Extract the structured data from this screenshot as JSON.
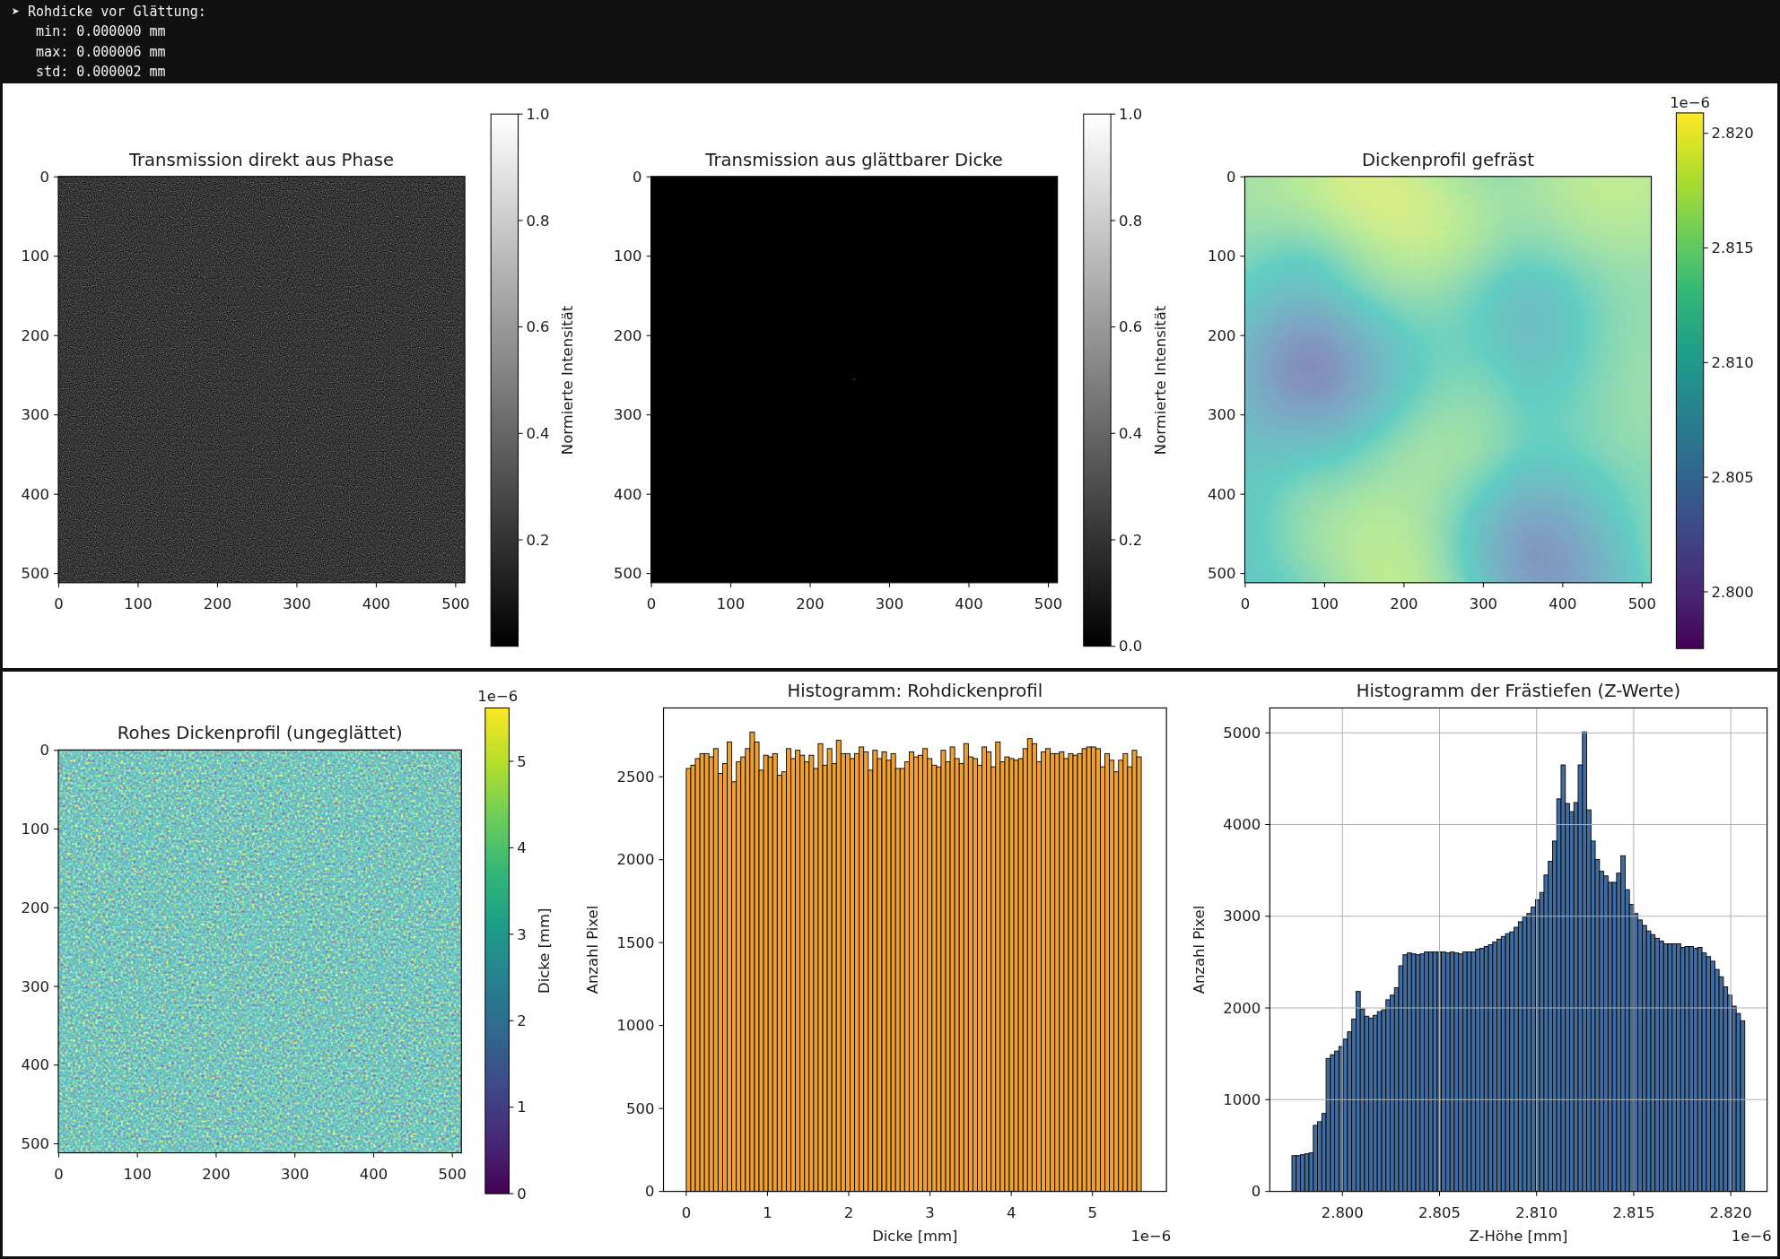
{
  "terminal": {
    "lines": [
      "➤ Rohdicke vor Glättung:",
      "   min: 0.000000 mm",
      "   max: 0.000006 mm",
      "   std: 0.000002 mm"
    ]
  },
  "figures": [
    {
      "panels": [
        {
          "kind": "speckle",
          "title": "Transmission direkt aus Phase",
          "xticks": [
            "0",
            "100",
            "200",
            "300",
            "400",
            "500"
          ],
          "yticks": [
            "0",
            "100",
            "200",
            "300",
            "400",
            "500"
          ],
          "colorbar": {
            "label": "Normierte Intensität",
            "ticks": [
              "1.0",
              "0.8",
              "0.6",
              "0.4",
              "0.2"
            ]
          }
        },
        {
          "kind": "blank",
          "title": "Transmission aus glättbarer Dicke",
          "xticks": [
            "0",
            "100",
            "200",
            "300",
            "400",
            "500"
          ],
          "yticks": [
            "0",
            "100",
            "200",
            "300",
            "400",
            "500"
          ],
          "colorbar": {
            "label": "Normierte Intensität",
            "ticks": [
              "1.0",
              "0.8",
              "0.6",
              "0.4",
              "0.2",
              "0.0"
            ]
          }
        },
        {
          "kind": "smooth",
          "title": "Dickenprofil gefräst",
          "xticks": [
            "0",
            "100",
            "200",
            "300",
            "400",
            "500"
          ],
          "yticks": [
            "0",
            "100",
            "200",
            "300",
            "400",
            "500"
          ],
          "colorbar": {
            "offset_text": "1e−6",
            "ticks": [
              "2.820",
              "2.815",
              "2.810",
              "2.805",
              "2.800"
            ]
          }
        }
      ]
    },
    {
      "panels": [
        {
          "kind": "noise",
          "title": "Rohes Dickenprofil (ungeglättet)",
          "xticks": [
            "0",
            "100",
            "200",
            "300",
            "400",
            "500"
          ],
          "yticks": [
            "0",
            "100",
            "200",
            "300",
            "400",
            "500"
          ],
          "colorbar": {
            "label": "Dicke [mm]",
            "offset_text": "1e−6",
            "ticks": [
              "5",
              "4",
              "3",
              "2",
              "1",
              "0"
            ]
          }
        },
        {
          "kind": "histogram",
          "chart_data": {
            "type": "bar",
            "title": "Histogramm: Rohdickenprofil",
            "xlabel": "Dicke [mm]",
            "ylabel": "Anzahl Pixel",
            "annotations": [
              {
                "text": "1e−6"
              }
            ],
            "x": [
              0.028,
              0.084,
              0.14,
              0.196,
              0.252,
              0.308,
              0.364,
              0.42,
              0.476,
              0.532,
              0.588,
              0.644,
              0.7,
              0.756,
              0.812,
              0.868,
              0.924,
              0.98,
              1.036,
              1.092,
              1.148,
              1.204,
              1.26,
              1.316,
              1.372,
              1.428,
              1.484,
              1.54,
              1.596,
              1.652,
              1.708,
              1.764,
              1.82,
              1.876,
              1.932,
              1.988,
              2.044,
              2.1,
              2.156,
              2.212,
              2.268,
              2.324,
              2.38,
              2.436,
              2.492,
              2.548,
              2.604,
              2.66,
              2.716,
              2.772,
              2.828,
              2.884,
              2.94,
              2.996,
              3.052,
              3.108,
              3.164,
              3.22,
              3.276,
              3.332,
              3.388,
              3.444,
              3.5,
              3.556,
              3.612,
              3.668,
              3.724,
              3.78,
              3.836,
              3.892,
              3.948,
              4.004,
              4.06,
              4.116,
              4.172,
              4.228,
              4.284,
              4.34,
              4.396,
              4.452,
              4.508,
              4.564,
              4.62,
              4.676,
              4.732,
              4.788,
              4.844,
              4.9,
              4.956,
              5.012,
              5.068,
              5.124,
              5.18,
              5.236,
              5.292,
              5.348,
              5.404,
              5.46,
              5.516,
              5.572
            ],
            "series": [
              {
                "color": "#f0a030",
                "values": [
                  2550,
                  2570,
                  2610,
                  2640,
                  2640,
                  2620,
                  2670,
                  2520,
                  2580,
                  2710,
                  2470,
                  2590,
                  2620,
                  2670,
                  2770,
                  2710,
                  2540,
                  2630,
                  2620,
                  2640,
                  2510,
                  2530,
                  2670,
                  2610,
                  2660,
                  2630,
                  2590,
                  2630,
                  2550,
                  2700,
                  2570,
                  2670,
                  2580,
                  2720,
                  2640,
                  2640,
                  2610,
                  2640,
                  2680,
                  2650,
                  2540,
                  2660,
                  2610,
                  2650,
                  2600,
                  2640,
                  2550,
                  2550,
                  2590,
                  2650,
                  2620,
                  2630,
                  2670,
                  2610,
                  2570,
                  2560,
                  2660,
                  2590,
                  2680,
                  2610,
                  2580,
                  2700,
                  2620,
                  2610,
                  2570,
                  2680,
                  2650,
                  2560,
                  2710,
                  2590,
                  2620,
                  2610,
                  2600,
                  2610,
                  2670,
                  2730,
                  2700,
                  2590,
                  2650,
                  2670,
                  2640,
                  2640,
                  2650,
                  2610,
                  2640,
                  2630,
                  2640,
                  2670,
                  2680,
                  2680,
                  2670,
                  2560,
                  2640,
                  2600,
                  2530,
                  2600,
                  2640,
                  2560,
                  2660,
                  2620
                ]
              }
            ],
            "xlim": [
              -0.28,
              5.91
            ],
            "ylim": [
              0,
              2915
            ],
            "xticks": [
              {
                "value": 0,
                "label": "0"
              },
              {
                "value": 1,
                "label": "1"
              },
              {
                "value": 2,
                "label": "2"
              },
              {
                "value": 3,
                "label": "3"
              },
              {
                "value": 4,
                "label": "4"
              },
              {
                "value": 5,
                "label": "5"
              }
            ],
            "yticks": [
              {
                "value": 0,
                "label": "0"
              },
              {
                "value": 500,
                "label": "500"
              },
              {
                "value": 1000,
                "label": "1000"
              },
              {
                "value": 1500,
                "label": "1500"
              },
              {
                "value": 2000,
                "label": "2000"
              },
              {
                "value": 2500,
                "label": "2500"
              }
            ]
          }
        },
        {
          "kind": "histogram",
          "chart_data": {
            "type": "bar",
            "title": "Histogramm der Frästiefen (Z-Werte)",
            "xlabel": "Z-Höhe [mm]",
            "ylabel": "Anzahl Pixel",
            "annotations": [
              {
                "text": "1e−6"
              }
            ],
            "grid": true,
            "x": [
              2.79751,
              2.79773,
              2.79795,
              2.79817,
              2.79839,
              2.79861,
              2.79883,
              2.79905,
              2.79927,
              2.79949,
              2.79971,
              2.79993,
              2.80015,
              2.80037,
              2.80059,
              2.80081,
              2.80103,
              2.80125,
              2.80147,
              2.80169,
              2.80191,
              2.80213,
              2.80235,
              2.80257,
              2.80279,
              2.80301,
              2.80323,
              2.80345,
              2.80367,
              2.80389,
              2.80411,
              2.80433,
              2.80455,
              2.80477,
              2.80499,
              2.80521,
              2.80543,
              2.80565,
              2.80587,
              2.80609,
              2.80631,
              2.80653,
              2.80675,
              2.80697,
              2.80719,
              2.80741,
              2.80763,
              2.80785,
              2.80807,
              2.80829,
              2.80851,
              2.80873,
              2.80895,
              2.80917,
              2.80939,
              2.80961,
              2.80983,
              2.81005,
              2.81027,
              2.81049,
              2.81071,
              2.81093,
              2.81115,
              2.81137,
              2.81159,
              2.81181,
              2.81203,
              2.81225,
              2.81247,
              2.81269,
              2.81291,
              2.81313,
              2.81335,
              2.81357,
              2.81379,
              2.81401,
              2.81423,
              2.81445,
              2.81467,
              2.81489,
              2.81511,
              2.81533,
              2.81555,
              2.81577,
              2.81599,
              2.81621,
              2.81643,
              2.81665,
              2.81687,
              2.81709,
              2.81731,
              2.81753,
              2.81775,
              2.81797,
              2.81819,
              2.81841,
              2.81863,
              2.81885,
              2.81907,
              2.81929,
              2.81951,
              2.81973,
              2.81995,
              2.82017,
              2.82039,
              2.82061
            ],
            "series": [
              {
                "color": "#416c9f",
                "values": [
                  390,
                  390,
                  400,
                  410,
                  420,
                  720,
                  760,
                  850,
                  1450,
                  1490,
                  1530,
                  1580,
                  1660,
                  1740,
                  1880,
                  2180,
                  1990,
                  1910,
                  1890,
                  1920,
                  1960,
                  1980,
                  2090,
                  2140,
                  2220,
                  2460,
                  2580,
                  2600,
                  2590,
                  2580,
                  2590,
                  2610,
                  2610,
                  2610,
                  2610,
                  2610,
                  2600,
                  2610,
                  2600,
                  2590,
                  2610,
                  2610,
                  2610,
                  2640,
                  2650,
                  2670,
                  2690,
                  2720,
                  2750,
                  2780,
                  2810,
                  2830,
                  2880,
                  2940,
                  2990,
                  3030,
                  3100,
                  3180,
                  3260,
                  3450,
                  3600,
                  3820,
                  4280,
                  4650,
                  4230,
                  4140,
                  4240,
                  4650,
                  5010,
                  4160,
                  3820,
                  3620,
                  3490,
                  3440,
                  3370,
                  3370,
                  3470,
                  3660,
                  3290,
                  3130,
                  3030,
                  2960,
                  2900,
                  2840,
                  2800,
                  2760,
                  2730,
                  2700,
                  2700,
                  2700,
                  2700,
                  2660,
                  2670,
                  2670,
                  2650,
                  2660,
                  2600,
                  2560,
                  2510,
                  2420,
                  2340,
                  2230,
                  2140,
                  2020,
                  1940,
                  1860
                ]
              }
            ],
            "xlim": [
              2.79626,
              2.82187
            ],
            "ylim": [
              0,
              5271
            ],
            "xticks": [
              {
                "value": 2.8,
                "label": "2.800"
              },
              {
                "value": 2.805,
                "label": "2.805"
              },
              {
                "value": 2.81,
                "label": "2.810"
              },
              {
                "value": 2.815,
                "label": "2.815"
              },
              {
                "value": 2.82,
                "label": "2.820"
              }
            ],
            "yticks": [
              {
                "value": 0,
                "label": "0"
              },
              {
                "value": 1000,
                "label": "1000"
              },
              {
                "value": 2000,
                "label": "2000"
              },
              {
                "value": 3000,
                "label": "3000"
              },
              {
                "value": 4000,
                "label": "4000"
              },
              {
                "value": 5000,
                "label": "5000"
              }
            ]
          }
        }
      ]
    }
  ]
}
